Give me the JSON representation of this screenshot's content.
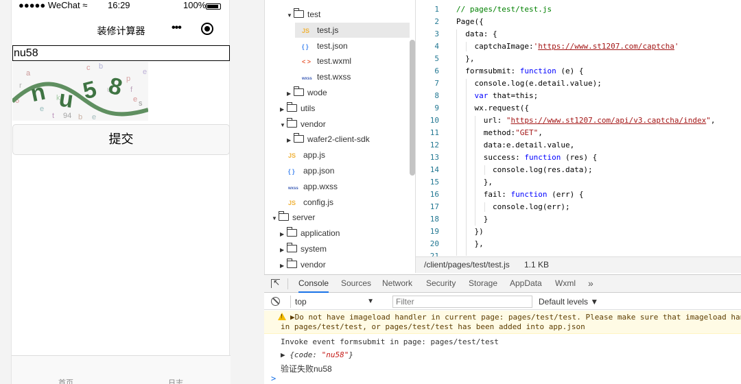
{
  "simulator": {
    "status": {
      "carrier": "●●●●● WeChat ≈",
      "time": "16:29",
      "battery": "100%"
    },
    "nav_title": "装修计算器",
    "capsule_more": "•••",
    "captcha_value": "nu58",
    "captcha_image_text": "nu58",
    "submit_label": "提交",
    "tabs": [
      "首页",
      "日志"
    ]
  },
  "file_tree": {
    "items": [
      {
        "label": "test",
        "type": "folder-open"
      },
      {
        "label": "test.js",
        "type": "js",
        "icon": "JS",
        "active": true
      },
      {
        "label": "test.json",
        "type": "json",
        "icon": "{ }"
      },
      {
        "label": "test.wxml",
        "type": "wxml",
        "icon": "< >"
      },
      {
        "label": "test.wxss",
        "type": "wxss",
        "icon": "wxss"
      },
      {
        "label": "wode",
        "type": "folder"
      },
      {
        "label": "utils",
        "type": "folder"
      },
      {
        "label": "vendor",
        "type": "folder-open"
      },
      {
        "label": "wafer2-client-sdk",
        "type": "folder"
      },
      {
        "label": "app.js",
        "type": "js",
        "icon": "JS"
      },
      {
        "label": "app.json",
        "type": "json",
        "icon": "{ }"
      },
      {
        "label": "app.wxss",
        "type": "wxss",
        "icon": "wxss"
      },
      {
        "label": "config.js",
        "type": "js",
        "icon": "JS"
      },
      {
        "label": "server",
        "type": "folder-open"
      },
      {
        "label": "application",
        "type": "folder"
      },
      {
        "label": "system",
        "type": "folder"
      },
      {
        "label": "vendor",
        "type": "folder"
      }
    ]
  },
  "editor": {
    "line_numbers": [
      "1",
      "2",
      "3",
      "4",
      "5",
      "6",
      "7",
      "8",
      "9",
      "10",
      "11",
      "12",
      "13",
      "14",
      "15",
      "16",
      "17",
      "18",
      "19",
      "20",
      "21"
    ],
    "lines": [
      "// pages/test/test.js",
      "Page({",
      "  data: {",
      "    captchaImage:'https://www.st1207.com/captcha'",
      "  },",
      "  formsubmit: function (e) {",
      "    console.log(e.detail.value);",
      "    var that=this;",
      "    wx.request({",
      "      url: \"https://www.st1207.com/api/v3.captcha/index\",",
      "      method:\"GET\",",
      "      data:e.detail.value,",
      "      success: function (res) {",
      "        console.log(res.data);",
      "      },",
      "      fail: function (err) {",
      "        console.log(err);",
      "      }",
      "    })",
      "    },",
      ""
    ],
    "status_path": "/client/pages/test/test.js",
    "status_size": "1.1 KB"
  },
  "devtools": {
    "tabs": [
      "Console",
      "Sources",
      "Network",
      "Security",
      "Storage",
      "AppData",
      "Wxml",
      "»"
    ],
    "active_tab": "Console",
    "context": "top",
    "filter_placeholder": "Filter",
    "levels": "Default levels ▼",
    "warning_line1": "▶Do not have imageload handler in current page: pages/test/test. Please make sure that imageload han",
    "warning_line2": "in pages/test/test, or pages/test/test has been added into app.json",
    "log1": "Invoke event formsubmit in page: pages/test/test",
    "obj_prefix": "▶ {code: ",
    "obj_value": "\"nu58\"",
    "obj_suffix": "}",
    "log2": "验证失败nu58",
    "prompt": ">"
  },
  "colors": {
    "accent": "#1a73e8",
    "warning_bg": "#fffbe5",
    "keyword": "#0000ff",
    "string": "#a31515",
    "comment": "#008000",
    "line_number": "#237893"
  }
}
